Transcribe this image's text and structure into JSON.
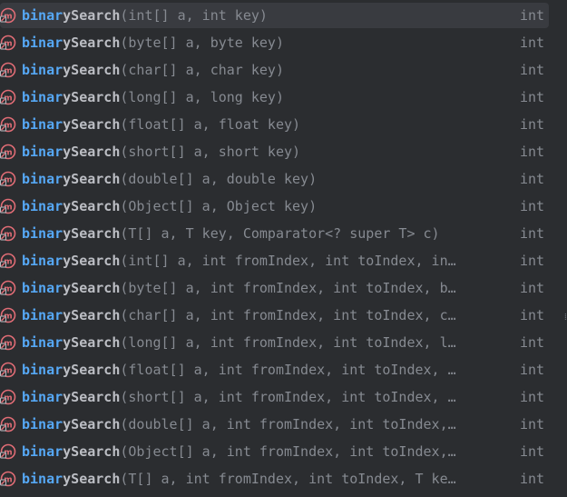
{
  "popup": {
    "title": "completion-popup",
    "highlight_color": "#56a8f5",
    "icon_color": "#e06c75",
    "items": [
      {
        "match": "binar",
        "rest": "ySearch",
        "signature": "(int[] a, int key)",
        "ret": "int",
        "selected": true
      },
      {
        "match": "binar",
        "rest": "ySearch",
        "signature": "(byte[] a, byte key)",
        "ret": "int"
      },
      {
        "match": "binar",
        "rest": "ySearch",
        "signature": "(char[] a, char key)",
        "ret": "int"
      },
      {
        "match": "binar",
        "rest": "ySearch",
        "signature": "(long[] a, long key)",
        "ret": "int"
      },
      {
        "match": "binar",
        "rest": "ySearch",
        "signature": "(float[] a, float key)",
        "ret": "int"
      },
      {
        "match": "binar",
        "rest": "ySearch",
        "signature": "(short[] a, short key)",
        "ret": "int"
      },
      {
        "match": "binar",
        "rest": "ySearch",
        "signature": "(double[] a, double key)",
        "ret": "int"
      },
      {
        "match": "binar",
        "rest": "ySearch",
        "signature": "(Object[] a, Object key)",
        "ret": "int"
      },
      {
        "match": "binar",
        "rest": "ySearch",
        "signature": "(T[] a, T key, Comparator<? super T> c)",
        "ret": "int"
      },
      {
        "match": "binar",
        "rest": "ySearch",
        "signature": "(int[] a, int fromIndex, int toIndex, in…",
        "ret": "int"
      },
      {
        "match": "binar",
        "rest": "ySearch",
        "signature": "(byte[] a, int fromIndex, int toIndex, b…",
        "ret": "int"
      },
      {
        "match": "binar",
        "rest": "ySearch",
        "signature": "(char[] a, int fromIndex, int toIndex, c…",
        "ret": "int"
      },
      {
        "match": "binar",
        "rest": "ySearch",
        "signature": "(long[] a, int fromIndex, int toIndex, l…",
        "ret": "int"
      },
      {
        "match": "binar",
        "rest": "ySearch",
        "signature": "(float[] a, int fromIndex, int toIndex, …",
        "ret": "int"
      },
      {
        "match": "binar",
        "rest": "ySearch",
        "signature": "(short[] a, int fromIndex, int toIndex, …",
        "ret": "int"
      },
      {
        "match": "binar",
        "rest": "ySearch",
        "signature": "(double[] a, int fromIndex, int toIndex,…",
        "ret": "int"
      },
      {
        "match": "binar",
        "rest": "ySearch",
        "signature": "(Object[] a, int fromIndex, int toIndex,…",
        "ret": "int"
      },
      {
        "match": "binar",
        "rest": "ySearch",
        "signature": "(T[] a, int fromIndex, int toIndex, T ke…",
        "ret": "int"
      }
    ]
  }
}
